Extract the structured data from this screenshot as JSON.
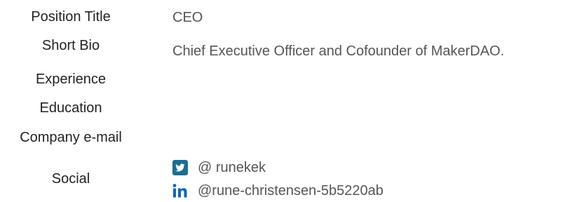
{
  "profile": {
    "fields": [
      {
        "label": "Position Title",
        "value": "CEO"
      },
      {
        "label": "Short Bio",
        "value": "Chief Executive Officer and Cofounder of MakerDAO."
      },
      {
        "label": "Experience",
        "value": ""
      },
      {
        "label": "Education",
        "value": ""
      },
      {
        "label": "Company e-mail",
        "value": ""
      }
    ],
    "social": {
      "label": "Social",
      "twitter": {
        "icon": "twitter-icon",
        "handle": "@ runekek",
        "color": "#1d6d95"
      },
      "linkedin": {
        "icon": "linkedin-icon",
        "handle": "@rune-christensen-5b5220ab",
        "color": "#0a66c2"
      }
    }
  }
}
